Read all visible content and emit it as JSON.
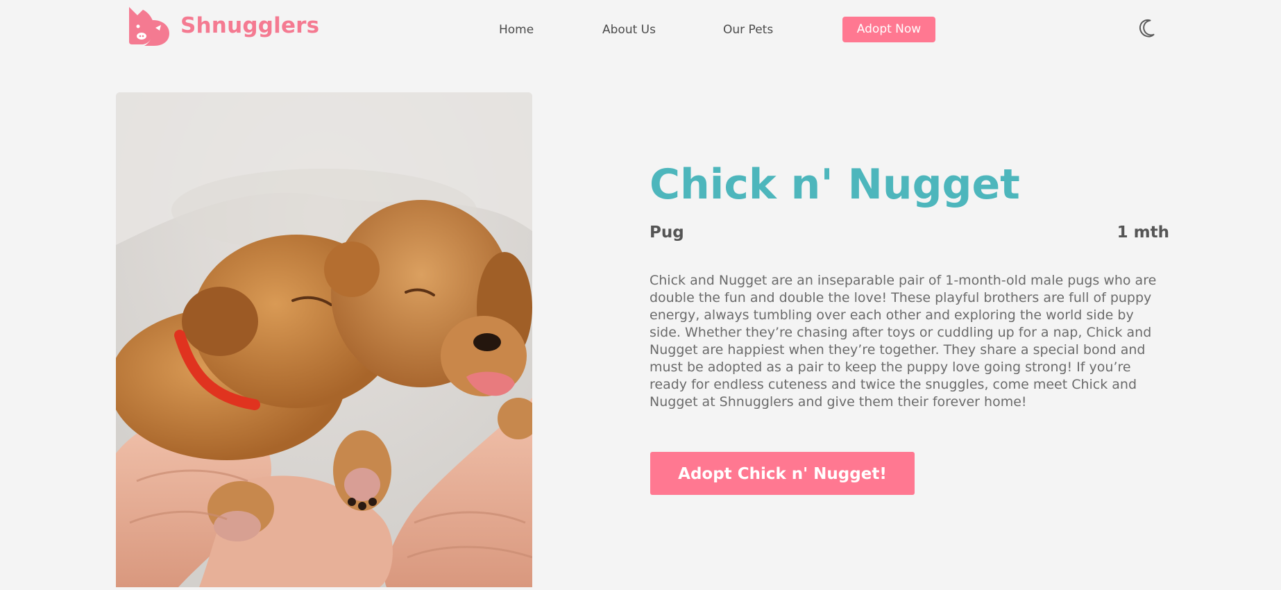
{
  "brand": {
    "name": "Shnugglers",
    "logo_icon": "pet-heads-logo-icon",
    "color": "#f47a91"
  },
  "nav": {
    "items": [
      {
        "label": "Home"
      },
      {
        "label": "About Us"
      },
      {
        "label": "Our Pets"
      }
    ],
    "cta_label": "Adopt Now",
    "theme_toggle_icon": "moon-icon"
  },
  "pet": {
    "name": "Chick n' Nugget",
    "breed": "Pug",
    "age": "1 mth",
    "description": "Chick and Nugget are an inseparable pair of 1-month-old male pugs who are double the fun and double the love! These playful brothers are full of puppy energy, always tumbling over each other and exploring the world side by side. Whether they’re chasing after toys or cuddling up for a nap, Chick and Nugget are happiest when they’re together. They share a special bond and must be adopted as a pair to keep the puppy love going strong! If you’re ready for endless cuteness and twice the snuggles, come meet Chick and Nugget at Shnugglers and give them their forever home!",
    "adopt_button_label": "Adopt Chick n' Nugget!",
    "photo": "two-sleeping-puppies-photo"
  },
  "colors": {
    "accent_pink": "#ff7891",
    "title_teal": "#4db6bc",
    "background": "#f4f4f4"
  }
}
